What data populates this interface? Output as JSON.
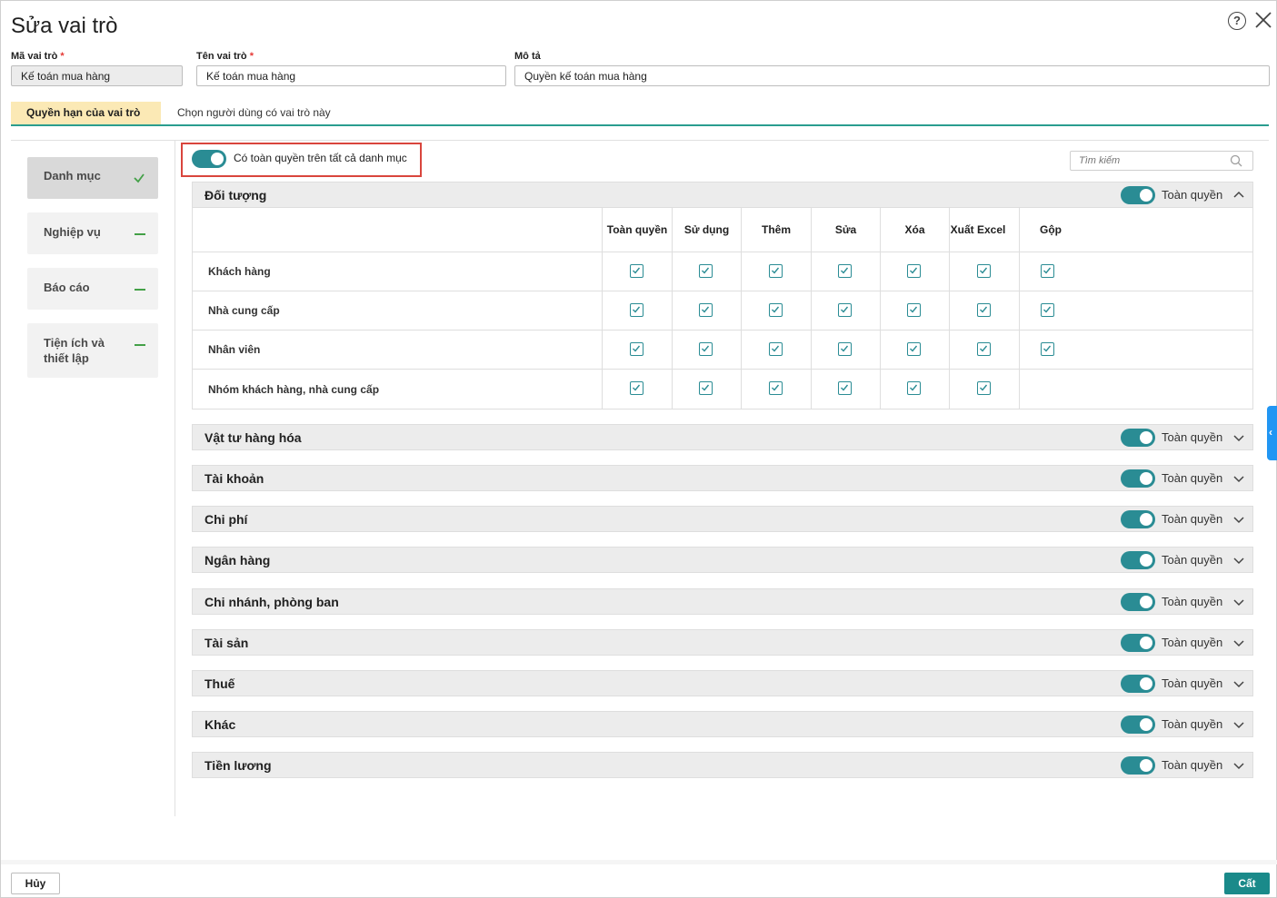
{
  "dialog": {
    "title": "Sửa vai trò",
    "help_glyph": "?"
  },
  "form": {
    "code": {
      "label": "Mã vai trò",
      "required_mark": "*",
      "value": "Kế toán mua hàng"
    },
    "name": {
      "label": "Tên vai trò",
      "required_mark": "*",
      "value": "Kế toán mua hàng"
    },
    "description": {
      "label": "Mô tả",
      "value": "Quyền kế toán mua hàng"
    }
  },
  "tabs": [
    {
      "label": "Quyền hạn của vai trò",
      "active": true
    },
    {
      "label": "Chọn người dùng có vai trò này",
      "active": false
    }
  ],
  "sidebar": {
    "items": [
      {
        "label": "Danh mục",
        "status": "check"
      },
      {
        "label": "Nghiệp vụ",
        "status": "dash"
      },
      {
        "label": "Báo cáo",
        "status": "dash"
      },
      {
        "label": "Tiện ích và thiết lập",
        "status": "dash"
      }
    ]
  },
  "master_toggle": {
    "label": "Có toàn quyền trên tất cả danh mục",
    "on": true
  },
  "search": {
    "placeholder": "Tìm kiếm"
  },
  "toggle_label": "Toàn quyền",
  "expanded_section": {
    "title": "Đối tượng",
    "columns": [
      "Toàn quyền",
      "Sử dụng",
      "Thêm",
      "Sửa",
      "Xóa",
      "Xuất Excel",
      "Gộp"
    ],
    "rows": [
      {
        "name": "Khách hàng",
        "checks": [
          true,
          true,
          true,
          true,
          true,
          true,
          true
        ]
      },
      {
        "name": "Nhà cung cấp",
        "checks": [
          true,
          true,
          true,
          true,
          true,
          true,
          true
        ]
      },
      {
        "name": "Nhân viên",
        "checks": [
          true,
          true,
          true,
          true,
          true,
          true,
          true
        ]
      },
      {
        "name": "Nhóm khách hàng, nhà cung cấp",
        "checks": [
          true,
          true,
          true,
          true,
          true,
          true,
          false
        ]
      }
    ]
  },
  "collapsed_sections": [
    {
      "title": "Vật tư hàng hóa"
    },
    {
      "title": "Tài khoản"
    },
    {
      "title": "Chi phí"
    },
    {
      "title": "Ngân hàng"
    },
    {
      "title": "Chi nhánh, phòng ban"
    },
    {
      "title": "Tài sản"
    },
    {
      "title": "Thuế"
    },
    {
      "title": "Khác"
    },
    {
      "title": "Tiền lương"
    }
  ],
  "footer": {
    "cancel_label": "Hủy",
    "save_label": "Cất"
  },
  "colors": {
    "accent": "#2a8c94",
    "tab_active_bg": "#fbe9b5",
    "highlight_border": "#d9453d",
    "save_button": "#1a8a8a"
  }
}
